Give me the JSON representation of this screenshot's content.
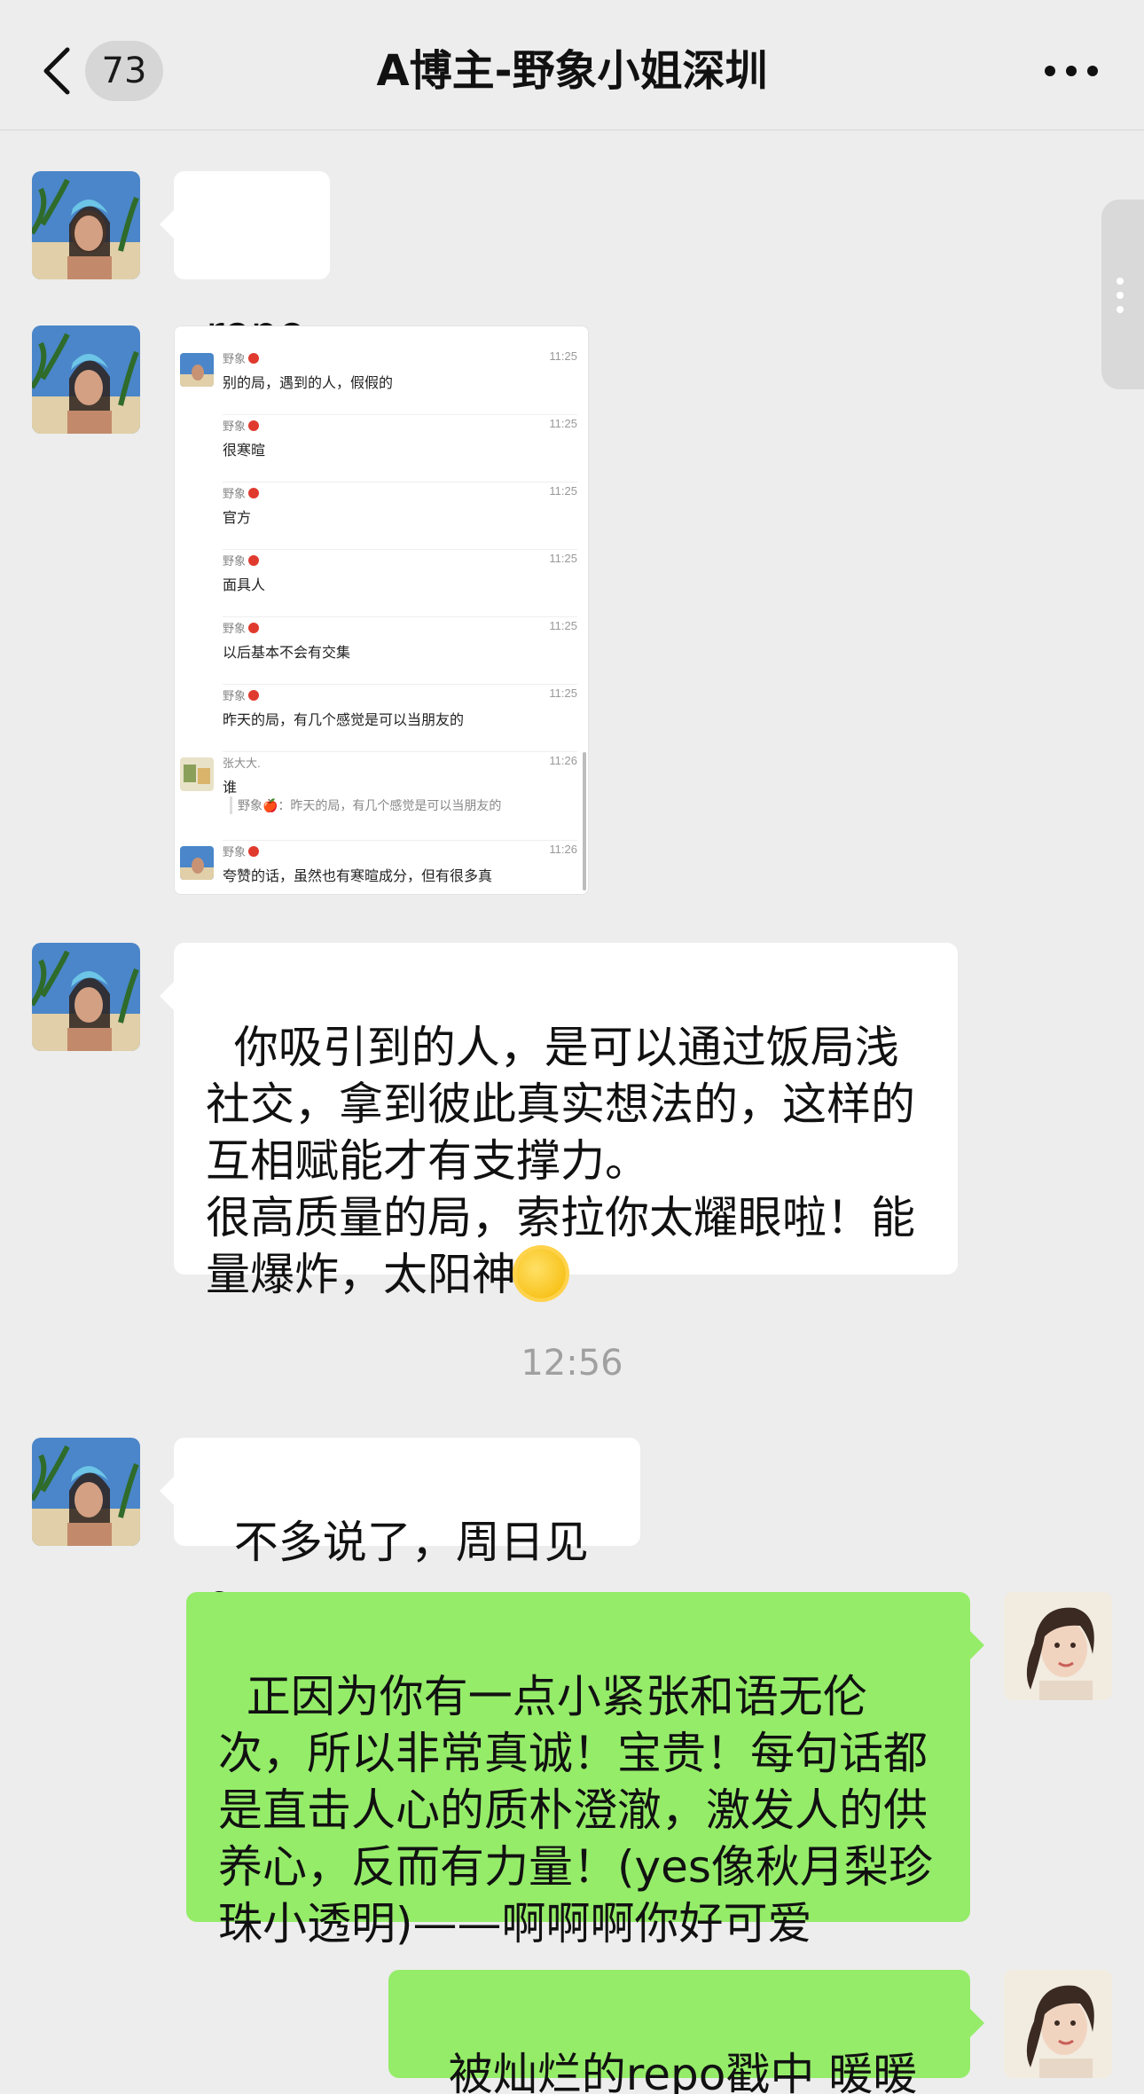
{
  "header": {
    "unread_count": "73",
    "title": "A博主-野象小姐深圳",
    "back_icon": "chevron-left-icon",
    "more_icon": "more-dots-icon"
  },
  "colors": {
    "background": "#ededed",
    "incoming_bubble": "#ffffff",
    "outgoing_bubble": "#95ec69",
    "timestamp": "#a0a0a0"
  },
  "messages": [
    {
      "side": "incoming",
      "type": "text",
      "text": "repo"
    },
    {
      "side": "incoming",
      "type": "image",
      "description_icon": "chat-screenshot-image"
    },
    {
      "side": "incoming",
      "type": "text",
      "text": "你吸引到的人，是可以通过饭局浅社交，拿到彼此真实想法的，这样的互相赋能才有支撑力。\n很高质量的局，索拉你太耀眼啦！能量爆炸，太阳神",
      "emoji": "sun-emoji-icon"
    },
    {
      "type": "timestamp",
      "text": "12:56"
    },
    {
      "side": "incoming",
      "type": "text",
      "text": "不多说了，周日见～"
    },
    {
      "side": "outgoing",
      "type": "text",
      "text": "正因为你有一点小紧张和语无伦次，所以非常真诚！宝贵！每句话都是直击人心的质朴澄澈，激发人的供养心，反而有力量！(yes像秋月梨珍珠小透明)——啊啊啊你好可爱"
    },
    {
      "side": "outgoing",
      "type": "text",
      "text": "被灿烂的repo戳中 暖暖的"
    }
  ],
  "screenshot": {
    "rows": [
      {
        "name": "野象",
        "time": "11:25",
        "text": "别的局，遇到的人，假假的",
        "has_avatar": true
      },
      {
        "name": "野象",
        "time": "11:25",
        "text": "很寒暄",
        "has_avatar": false
      },
      {
        "name": "野象",
        "time": "11:25",
        "text": "官方",
        "has_avatar": false
      },
      {
        "name": "野象",
        "time": "11:25",
        "text": "面具人",
        "has_avatar": false
      },
      {
        "name": "野象",
        "time": "11:25",
        "text": "以后基本不会有交集",
        "has_avatar": false
      },
      {
        "name": "野象",
        "time": "11:25",
        "text": "昨天的局，有几个感觉是可以当朋友的",
        "has_avatar": false
      },
      {
        "name": "张大大.",
        "time": "11:26",
        "text": "谁",
        "quote": "野象🍎：昨天的局，有几个感觉是可以当朋友的",
        "has_avatar": true
      },
      {
        "name": "野象",
        "time": "11:26",
        "text": "夸赞的话，虽然也有寒暄成分，但有很多真",
        "has_avatar": true
      }
    ]
  }
}
